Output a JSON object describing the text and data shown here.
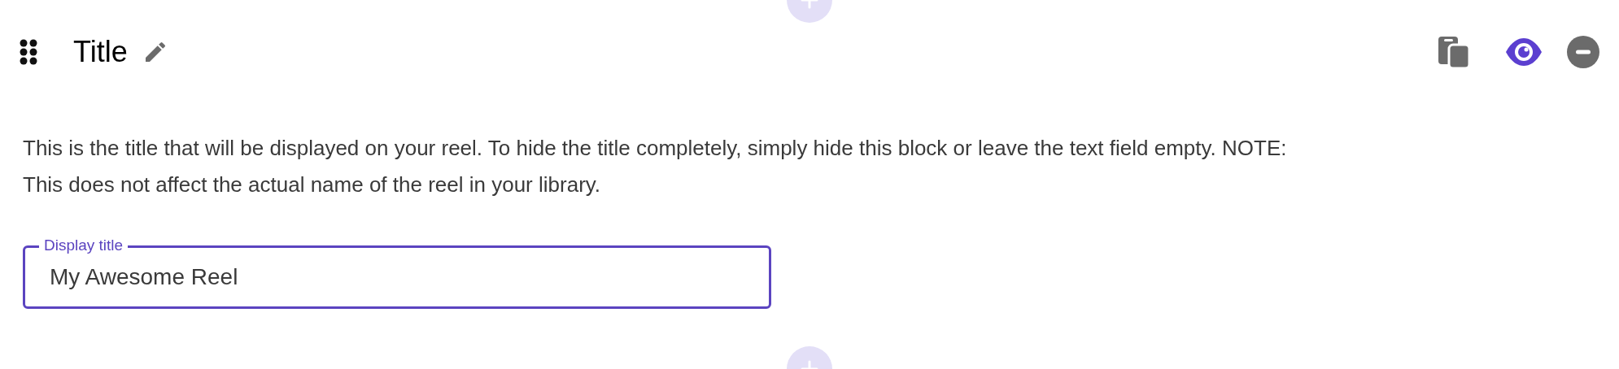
{
  "block": {
    "title": "Title",
    "visible": true
  },
  "description": "This is the title that will be displayed on your reel. To hide the title completely, simply hide this block or leave the text field empty. NOTE: This does not affect the actual name of the reel in your library.",
  "field": {
    "label": "Display title",
    "value": "My Awesome Reel",
    "focused": true
  }
}
